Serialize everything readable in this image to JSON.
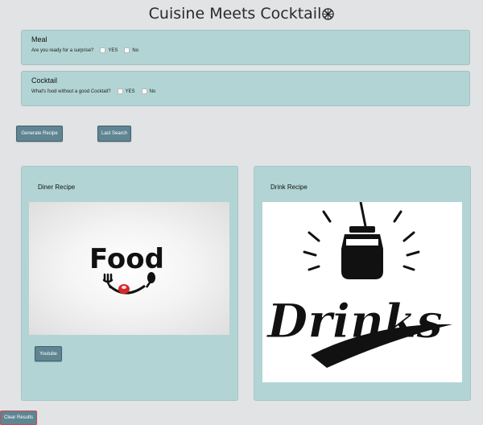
{
  "header": {
    "title": "Cuisine Meets Cocktail"
  },
  "meal": {
    "heading": "Meal",
    "question": "Are you ready for a surprise?",
    "yes_label": "YES",
    "no_label": "No"
  },
  "cocktail": {
    "heading": "Cocktail",
    "question": "What's food without a good Cocktail?",
    "yes_label": "YES",
    "no_label": "No"
  },
  "actions": {
    "generate_label": "Generate Recipe",
    "last_search_label": "Last Search",
    "clear_label": "Clear Results"
  },
  "diner": {
    "heading": "Diner Recipe",
    "image_text": "Food",
    "youtube_label": "Youtube"
  },
  "drink": {
    "heading": "Drink Recipe",
    "image_text": "Drinks"
  },
  "colors": {
    "panel": "#b2d4d4",
    "button": "#5e8591",
    "background": "#e2e3e5"
  }
}
